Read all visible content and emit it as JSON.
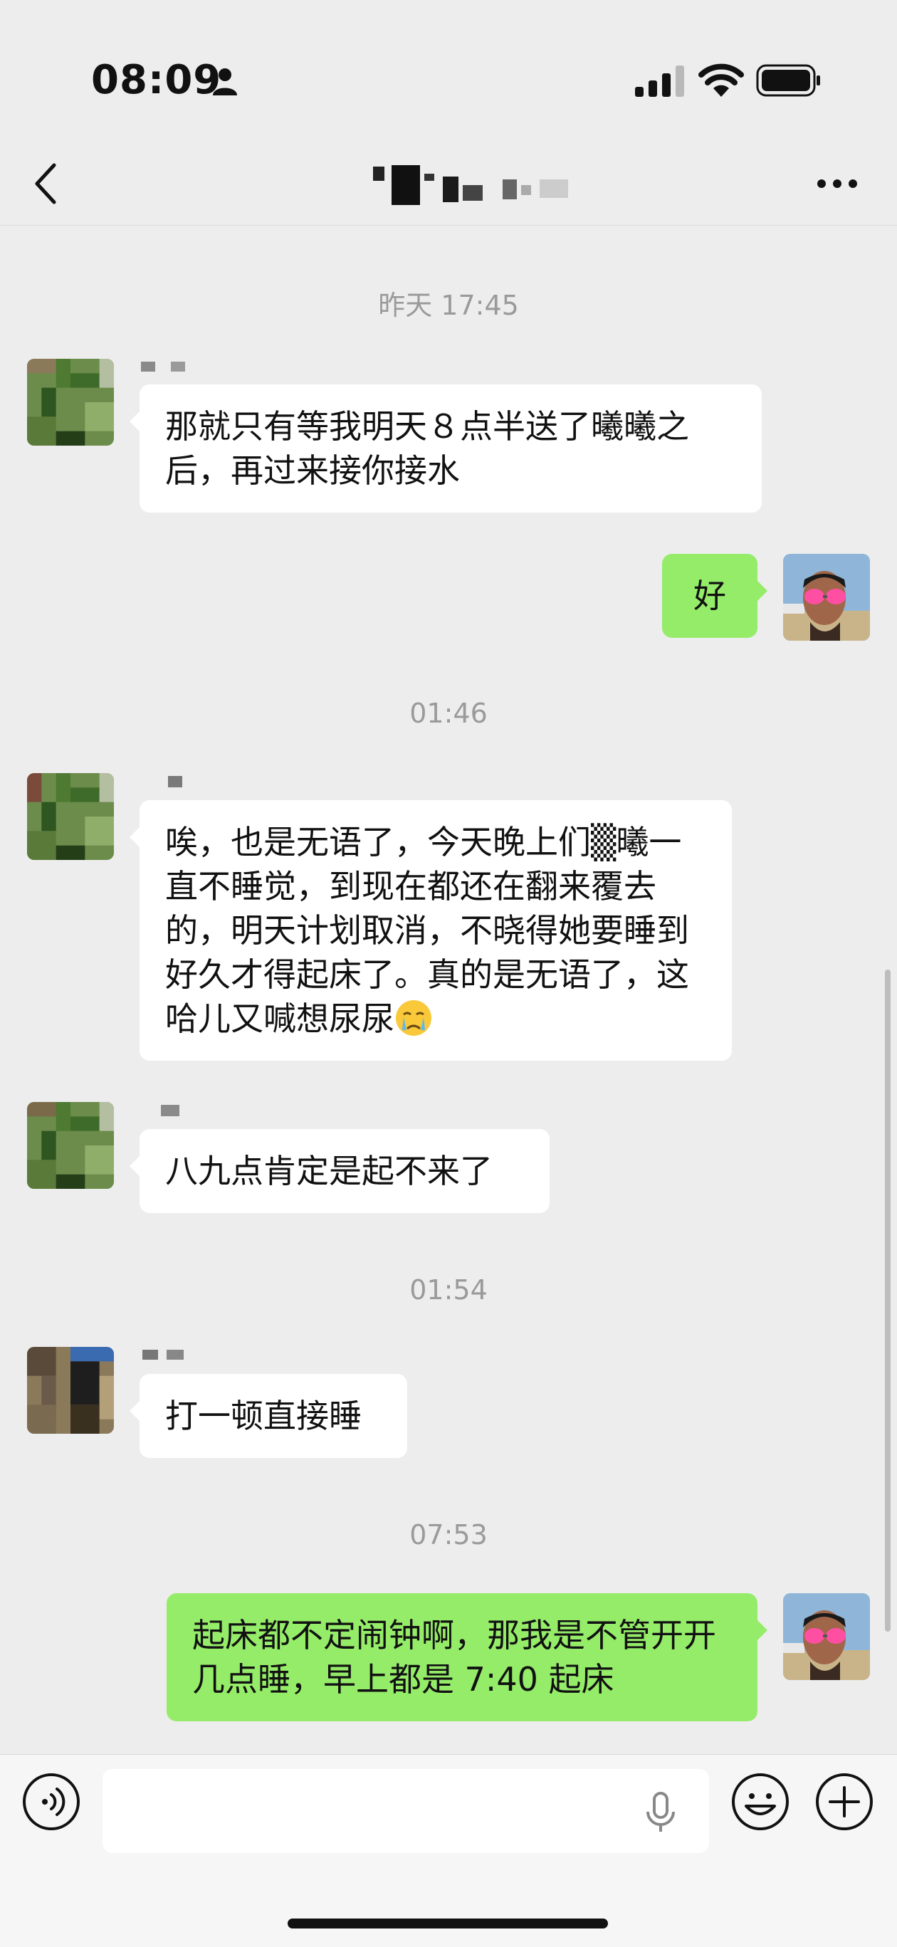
{
  "status_bar": {
    "time": "08:09"
  },
  "icons": {
    "person": "person-icon",
    "signal": "cellular-signal-icon",
    "wifi": "wifi-icon",
    "battery": "battery-icon",
    "back": "chevron-left-icon",
    "more": "more-dots-icon",
    "voice": "voice-toggle-icon",
    "mic": "microphone-icon",
    "emoji": "emoji-icon",
    "plus": "plus-icon"
  },
  "colors": {
    "background": "#ededed",
    "outgoing_bubble": "#95ec69",
    "incoming_bubble": "#ffffff",
    "timestamp": "#9a9a9a"
  },
  "chat": {
    "timestamps": [
      "昨天 17:45",
      "01:46",
      "01:54",
      "07:53"
    ],
    "messages": [
      {
        "direction": "incoming",
        "text": "那就只有等我明天８点半送了曦曦之后，再过来接你接水"
      },
      {
        "direction": "outgoing",
        "text": "好"
      },
      {
        "direction": "incoming",
        "text": "唉，也是无语了，今天晚上们▒曦一直不睡觉，到现在都还在翻来覆去的，明天计划取消，不晓得她要睡到好久才得起床了。真的是无语了，这哈儿又喊想尿尿",
        "emoji": "crying-face-emoji"
      },
      {
        "direction": "incoming",
        "text": "八九点肯定是起不来了"
      },
      {
        "direction": "incoming",
        "text": "打一顿直接睡"
      },
      {
        "direction": "outgoing",
        "text": "起床都不定闹钟啊，那我是不管开开几点睡，早上都是 7:40 起床"
      }
    ]
  },
  "input": {
    "value": ""
  }
}
